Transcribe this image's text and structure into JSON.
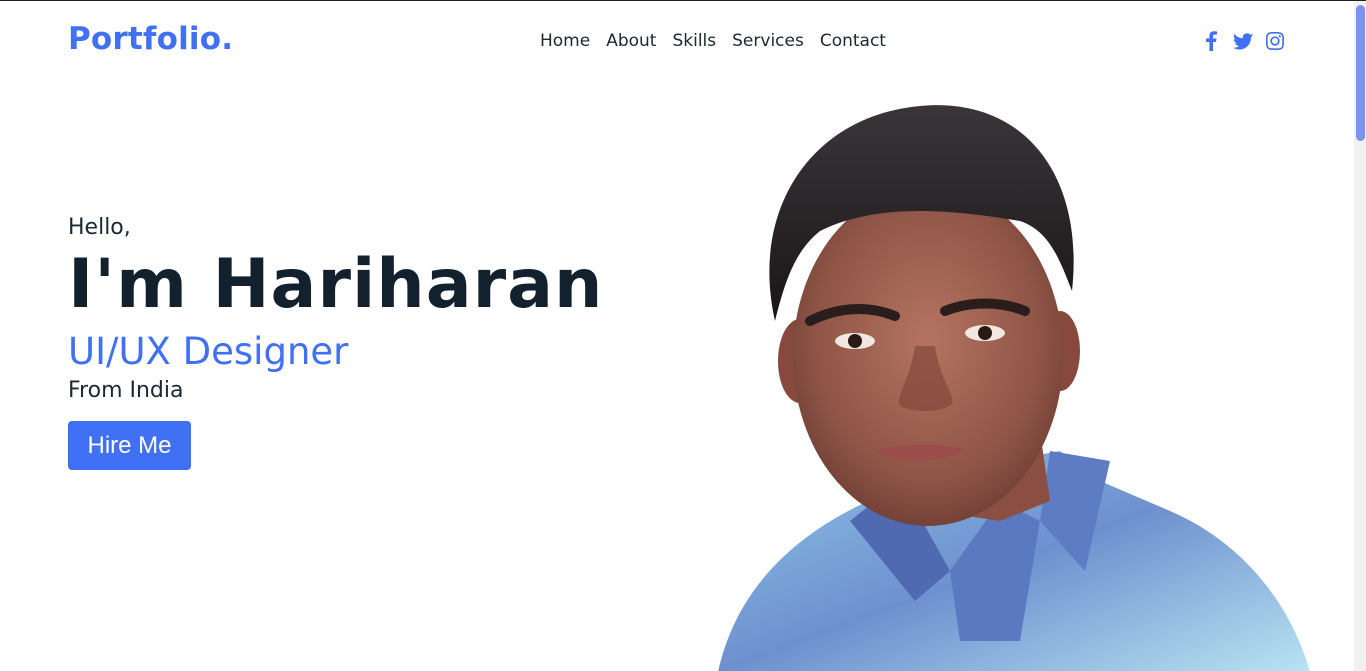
{
  "header": {
    "logo": "Portfolio.",
    "nav": [
      "Home",
      "About",
      "Skills",
      "Services",
      "Contact"
    ],
    "social_icons": [
      "facebook-icon",
      "twitter-icon",
      "instagram-icon"
    ]
  },
  "hero": {
    "greeting": "Hello,",
    "name": "I'm Hariharan",
    "role": "UI/UX Designer",
    "location": "From India",
    "cta_label": "Hire Me"
  },
  "colors": {
    "accent": "#4070f4",
    "heading": "#13212e",
    "text": "#1c2833",
    "background": "#ffffff"
  }
}
